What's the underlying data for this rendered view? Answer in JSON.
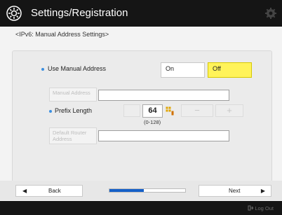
{
  "header": {
    "title": "Settings/Registration"
  },
  "breadcrumb": "<IPv6: Manual Address Settings>",
  "use_manual_address": {
    "label": "Use Manual Address",
    "options": [
      "On",
      "Off"
    ],
    "selected": "Off"
  },
  "manual_address": {
    "button_label": "Manual Address",
    "value": ""
  },
  "prefix_length": {
    "label": "Prefix Length",
    "value": "64",
    "range": "(0-128)",
    "minus_label": "−",
    "plus_label": "+"
  },
  "default_router": {
    "button_label": "Default Router Address",
    "value": ""
  },
  "nav": {
    "back_label": "Back",
    "next_label": "Next",
    "progress": 0.45
  },
  "footer": {
    "logout_label": "Log Out"
  },
  "colors": {
    "selected": "#fff35a",
    "accent": "#3b8fe0",
    "progress": "#1560c8"
  }
}
